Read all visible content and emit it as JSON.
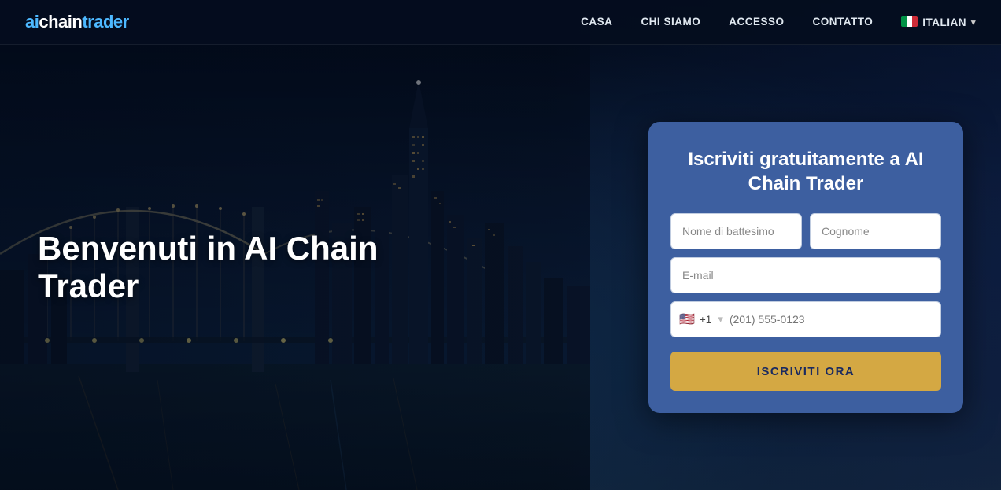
{
  "logo": {
    "ai": "ai",
    "chain": "chain",
    "trader": "trader"
  },
  "nav": {
    "links": [
      {
        "id": "casa",
        "label": "CASA"
      },
      {
        "id": "chi-siamo",
        "label": "CHI SIAMO"
      },
      {
        "id": "accesso",
        "label": "ACCESSO"
      },
      {
        "id": "contatto",
        "label": "CONTATTO"
      }
    ],
    "language": {
      "label": "ITALIAN",
      "flag": "🇮🇹",
      "chevron": "▾"
    }
  },
  "hero": {
    "title": "Benvenuti in AI Chain Trader"
  },
  "form": {
    "title": "Iscriviti gratuitamente a AI Chain Trader",
    "first_name_placeholder": "Nome di battesimo",
    "last_name_placeholder": "Cognome",
    "email_placeholder": "E-mail",
    "phone": {
      "flag": "🇺🇸",
      "code": "+1",
      "placeholder": "(201) 555-0123"
    },
    "submit_label": "ISCRIVITI ORA"
  }
}
